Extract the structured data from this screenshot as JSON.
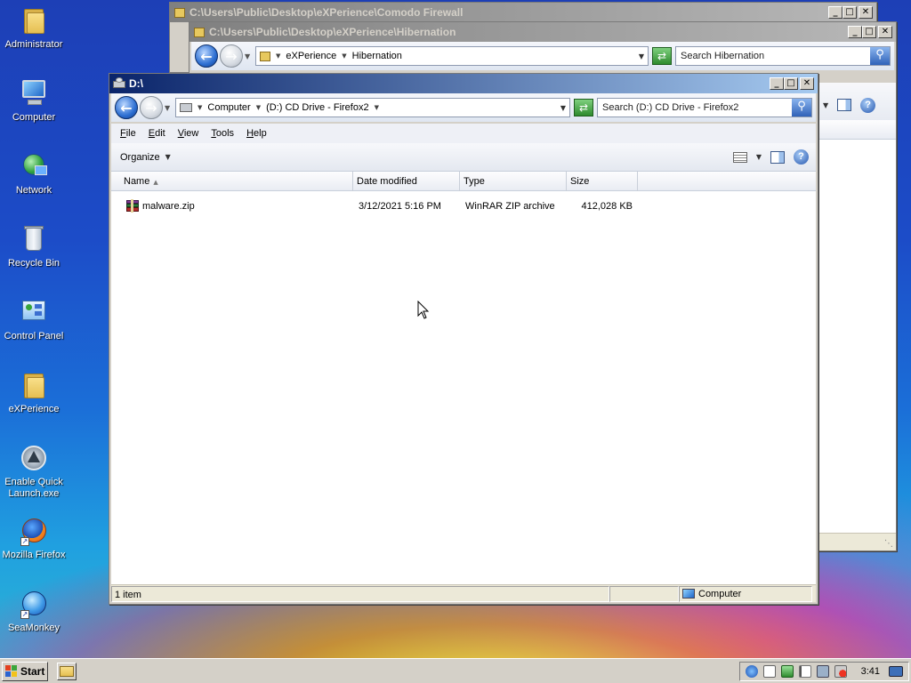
{
  "desktop": {
    "icons": [
      {
        "label": "Administrator"
      },
      {
        "label": "Computer"
      },
      {
        "label": "Network"
      },
      {
        "label": "Recycle Bin"
      },
      {
        "label": "Control Panel"
      },
      {
        "label": "eXPerience"
      },
      {
        "label": "Enable Quick Launch.exe"
      },
      {
        "label": "Mozilla Firefox"
      },
      {
        "label": "SeaMonkey"
      }
    ]
  },
  "window_back": {
    "title": "C:\\Users\\Public\\Desktop\\eXPerience\\Comodo Firewall"
  },
  "window_mid": {
    "title": "C:\\Users\\Public\\Desktop\\eXPerience\\Hibernation",
    "breadcrumb": [
      "eXPerience",
      "Hibernation"
    ],
    "search_placeholder": "Search Hibernation"
  },
  "window_front": {
    "title": "D:\\",
    "breadcrumb": [
      "Computer",
      "(D:) CD Drive - Firefox2"
    ],
    "search_placeholder": "Search (D:) CD Drive - Firefox2",
    "menu": [
      "File",
      "Edit",
      "View",
      "Tools",
      "Help"
    ],
    "organize_label": "Organize",
    "columns": [
      "Name",
      "Date modified",
      "Type",
      "Size"
    ],
    "files": [
      {
        "name": "malware.zip",
        "date_modified": "3/12/2021 5:16 PM",
        "type": "WinRAR ZIP archive",
        "size": "412,028 KB"
      }
    ],
    "status": {
      "count": "1 item",
      "location": "Computer"
    }
  },
  "taskbar": {
    "start_label": "Start",
    "clock": "3:41"
  },
  "icons": {
    "back": "arrow-left",
    "forward": "arrow-right",
    "refresh": "refresh",
    "search": "magnifier",
    "help": "question-mark"
  },
  "colors": {
    "active_title_start": "#0a246a",
    "active_title_end": "#a6caf0",
    "inactive_title": "#808080",
    "window_face": "#d4d0c8"
  }
}
